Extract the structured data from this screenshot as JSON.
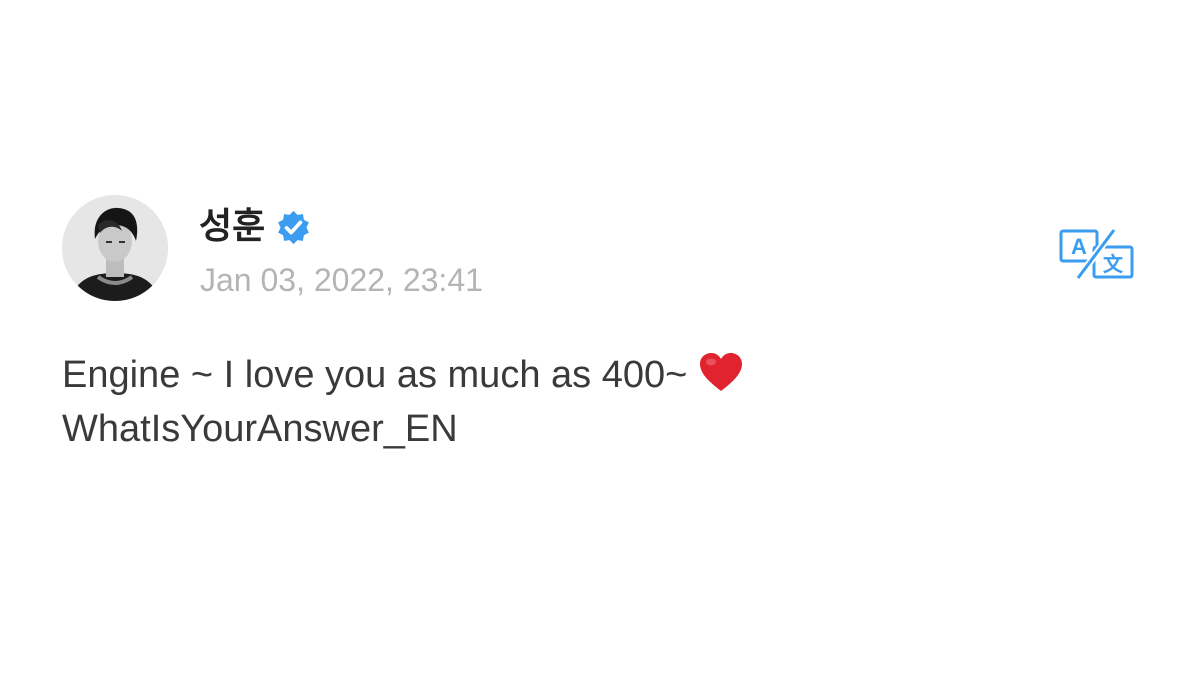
{
  "post": {
    "author": {
      "name": "성훈",
      "verified": true,
      "avatar_icon": "profile-photo-avatar"
    },
    "timestamp": "Jan 03, 2022, 23:41",
    "translate_icon": "translate-icon",
    "body": {
      "line1": "Engine ~ I love you as much as 400~ ",
      "line1_emoji": "red-heart-icon",
      "line2": "WhatIsYourAnswer_EN"
    }
  },
  "colors": {
    "background": "#ffffff",
    "name_text": "#222222",
    "timestamp_text": "#b4b4b4",
    "body_text": "#3a3a3a",
    "verified_badge": "#3b9cf0",
    "translate_icon": "#3b9cf0",
    "heart": "#e0232e"
  }
}
